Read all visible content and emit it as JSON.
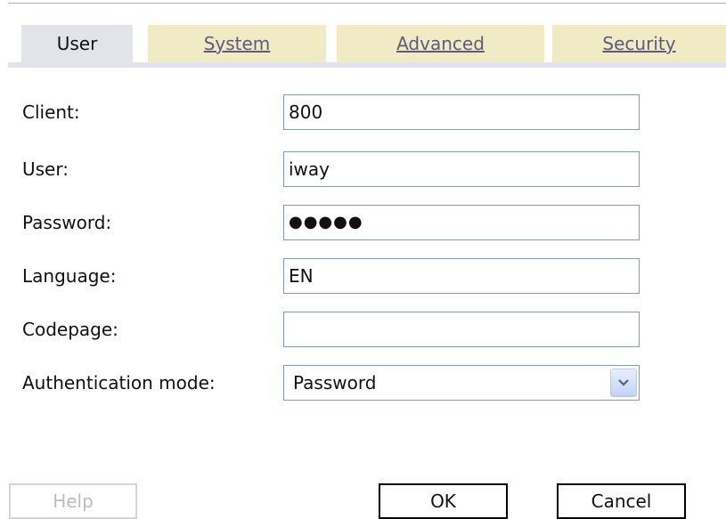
{
  "tabs": [
    {
      "label": "User",
      "active": true
    },
    {
      "label": "System",
      "active": false
    },
    {
      "label": "Advanced",
      "active": false
    },
    {
      "label": "Security",
      "active": false
    }
  ],
  "form": {
    "client": {
      "label": "Client:",
      "value": "800"
    },
    "user": {
      "label": "User:",
      "value": "iway"
    },
    "password": {
      "label": "Password:",
      "value": "●●●●●"
    },
    "language": {
      "label": "Language:",
      "value": "EN"
    },
    "codepage": {
      "label": "Codepage:",
      "value": ""
    },
    "auth_mode": {
      "label": "Authentication mode:",
      "value": "Password"
    }
  },
  "buttons": {
    "help": "Help",
    "ok": "OK",
    "cancel": "Cancel"
  },
  "colors": {
    "active_tab": "#e3e3ea",
    "inactive_tab": "#f0ebc4",
    "inactive_tab_text": "#5d5a7e",
    "field_border": "#7f9db9"
  },
  "icons": {
    "select_arrow": "chevron-down-icon"
  }
}
